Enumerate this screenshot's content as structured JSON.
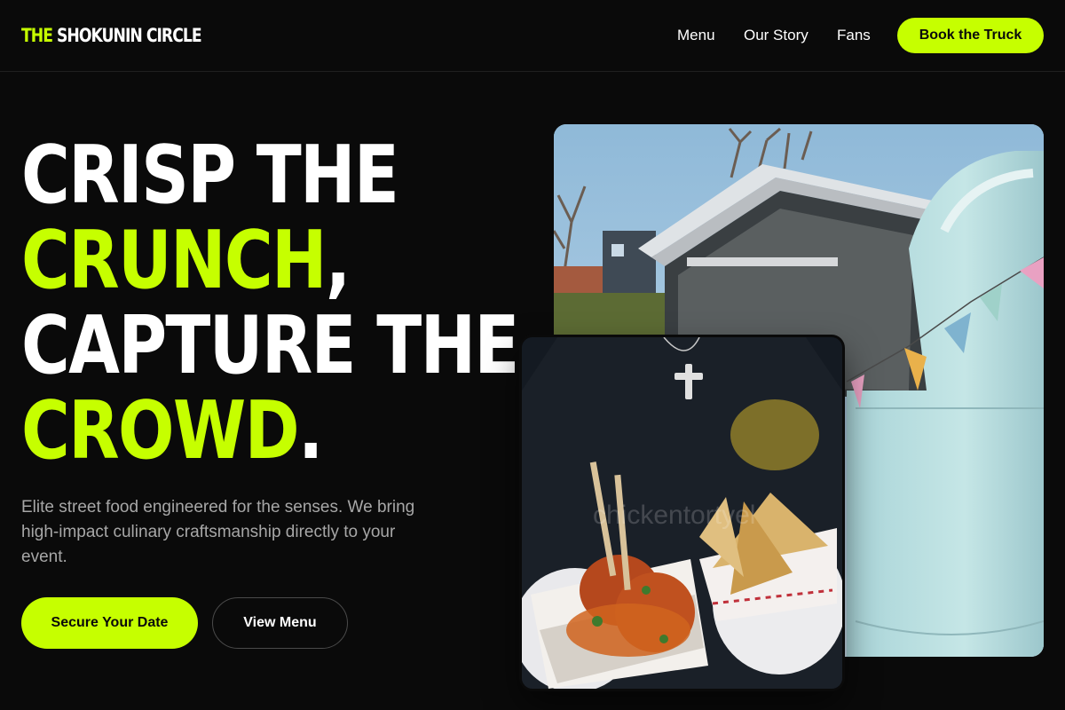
{
  "brand": {
    "logo_accent": "THE",
    "logo_rest": "SHOKUNIN CIRCLE"
  },
  "nav": {
    "items": [
      "Menu",
      "Our Story",
      "Fans"
    ],
    "cta_label": "Book the Truck"
  },
  "hero": {
    "title_line1": "CRISP THE",
    "title_line2_highlight": "CRUNCH",
    "title_line2_punct": ",",
    "title_line3": "CAPTURE THE",
    "title_line4_highlight": "CROWD",
    "title_line4_punct": ".",
    "subtitle": "Elite street food engineered for the senses. We bring high-impact culinary craftsmanship directly to your event.",
    "primary_button": "Secure Your Date",
    "secondary_button": "View Menu"
  },
  "images": {
    "truck_photo_icon": "food-truck-photo",
    "food_photo_icon": "meatballs-samosas-photo",
    "food_watermark": "chickentortyel"
  },
  "colors": {
    "accent": "#c6ff00",
    "background": "#0a0a0a",
    "text": "#ffffff",
    "muted_text": "#a7a7a7"
  }
}
